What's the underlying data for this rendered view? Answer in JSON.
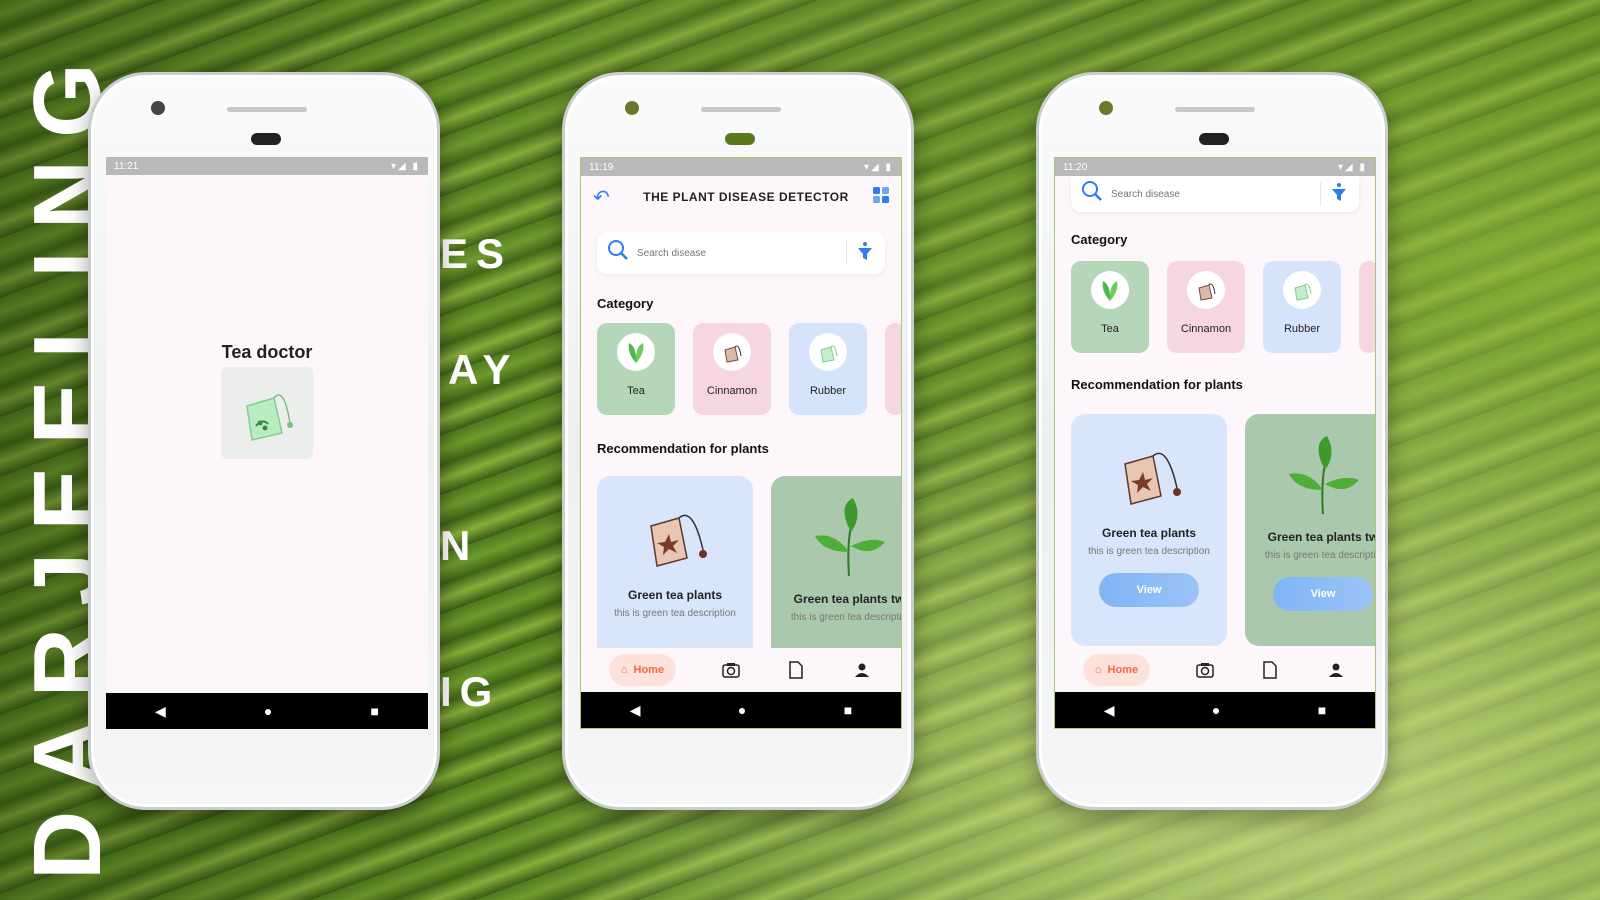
{
  "background": {
    "vertical_text": "DARJEELING",
    "fragments": [
      "ES",
      "AY",
      "N",
      "IG"
    ]
  },
  "phones": [
    {
      "status": {
        "time": "11:21",
        "icons": "▾◢ ▮"
      },
      "splash": {
        "title": "Tea doctor"
      }
    },
    {
      "status": {
        "time": "11:19",
        "icons": "▾◢ ▮"
      },
      "app": {
        "title": "THE PLANT DISEASE DETECTOR",
        "search_placeholder": "Search disease",
        "category_title": "Category",
        "categories": [
          {
            "label": "Tea",
            "bg": "#b6d6b9"
          },
          {
            "label": "Cinnamon",
            "bg": "#f6d6e3"
          },
          {
            "label": "Rubber",
            "bg": "#d6e4fb"
          }
        ],
        "rec_title": "Recommendation for plants",
        "recommendations": [
          {
            "title": "Green tea plants",
            "desc": "this is green tea description",
            "bg": "#d8e5fb"
          },
          {
            "title": "Green tea plants tw",
            "desc": "this is green tea descriptio",
            "bg": "#aac8ac"
          }
        ],
        "nav": {
          "home": "Home"
        }
      }
    },
    {
      "status": {
        "time": "11:20",
        "icons": "▾◢ ▮"
      },
      "app": {
        "search_placeholder": "Search disease",
        "category_title": "Category",
        "categories": [
          {
            "label": "Tea",
            "bg": "#b6d6b9"
          },
          {
            "label": "Cinnamon",
            "bg": "#f6d6e3"
          },
          {
            "label": "Rubber",
            "bg": "#d6e4fb"
          }
        ],
        "rec_title": "Recommendation for plants",
        "recommendations": [
          {
            "title": "Green tea plants",
            "desc": "this is green tea description",
            "view": "View",
            "bg": "#d8e5fb"
          },
          {
            "title": "Green tea plants tw",
            "desc": "this is green tea descriptio",
            "view": "View",
            "bg": "#aac8ac"
          }
        ],
        "nav": {
          "home": "Home"
        }
      }
    }
  ],
  "colors": {
    "accent_blue": "#2f7bf0",
    "home_orange": "#ef6b43"
  }
}
